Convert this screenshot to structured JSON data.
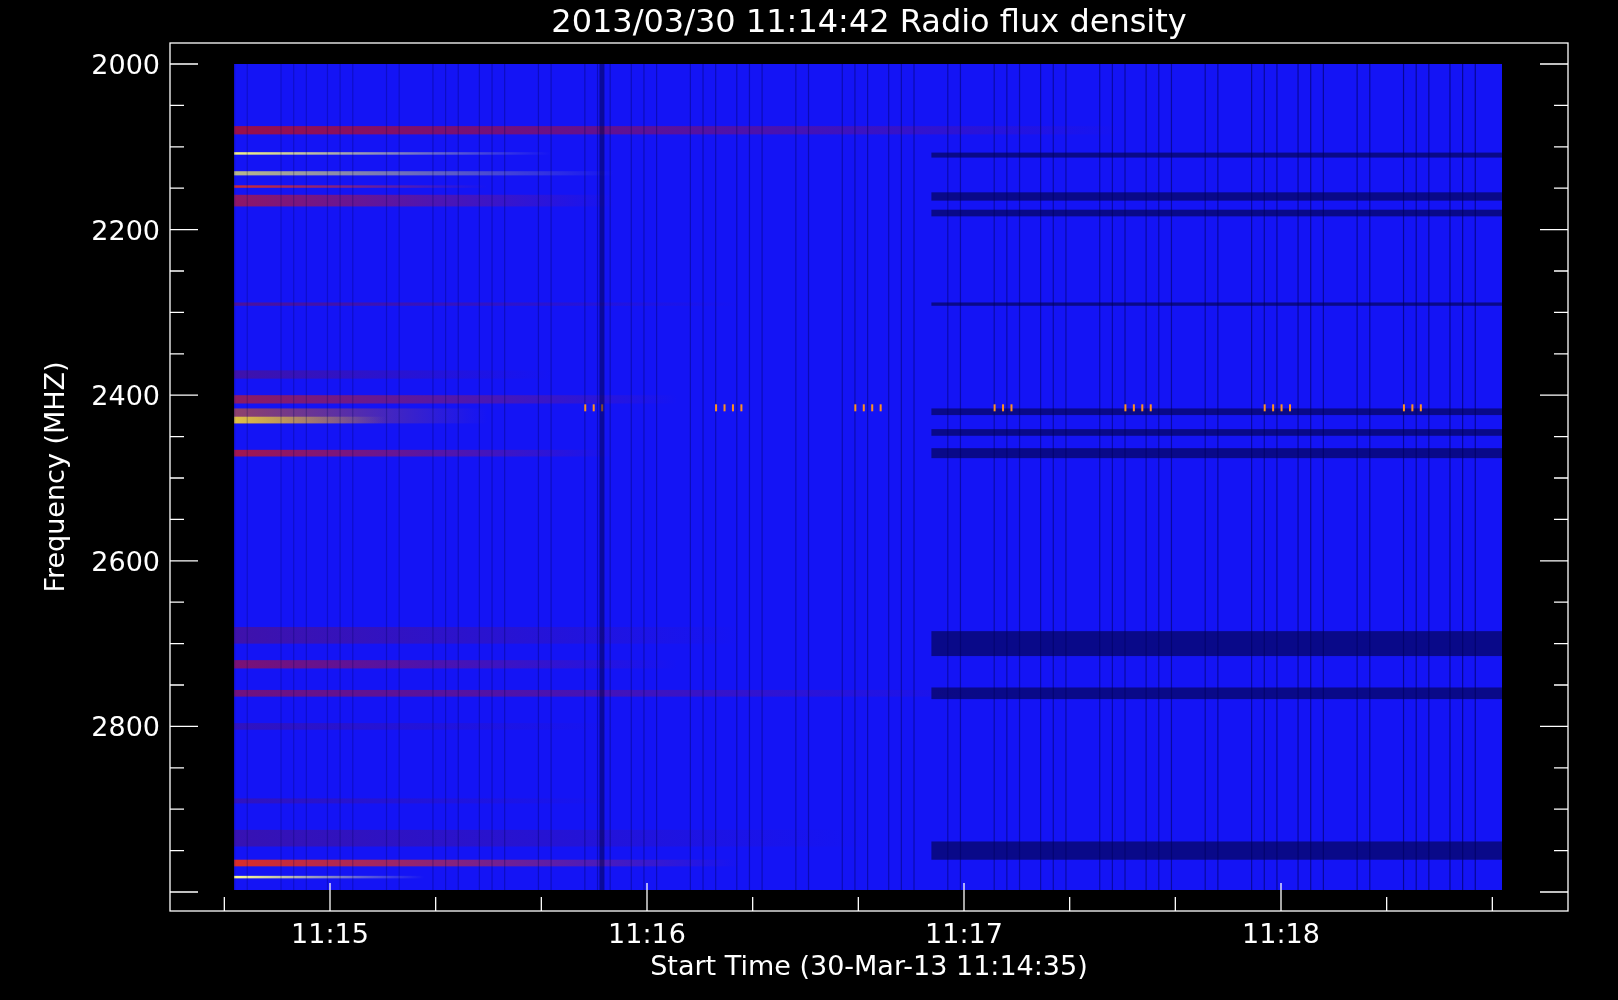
{
  "title": "2013/03/30 11:14:42 Radio flux density",
  "y_axis": {
    "label": "Frequency (MHZ)",
    "ticks": [
      "2000",
      "2200",
      "2400",
      "2600",
      "2800"
    ]
  },
  "x_axis": {
    "label": "Start Time (30-Mar-13 11:14:35)",
    "ticks": [
      "11:15",
      "11:16",
      "11:17",
      "11:18"
    ]
  }
}
